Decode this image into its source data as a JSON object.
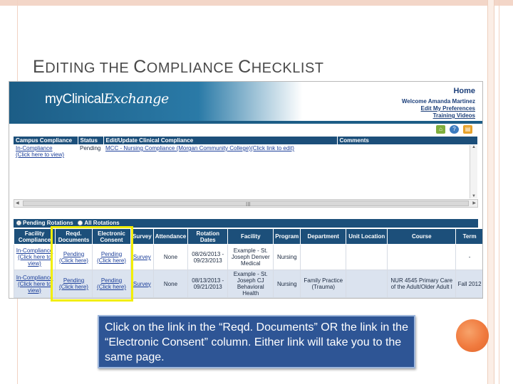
{
  "slide": {
    "title_parts": [
      "E",
      "DITING THE ",
      "C",
      "OMPLIANCE ",
      "C",
      "HECKLIST"
    ],
    "callout": "Click on the link in the “Reqd. Documents” OR the link in the “Electronic Consent” column.  Either link will take you to the same page."
  },
  "app": {
    "logo_prefix": "myClinical",
    "logo_suffix": "Exchange",
    "home": "Home",
    "welcome": "Welcome Amanda Martinez",
    "edit_prefs": "Edit My Preferences",
    "training": "Training Videos",
    "icons": [
      "home-icon",
      "help-icon",
      "print-icon"
    ]
  },
  "compliance": {
    "headers": [
      "Campus Compliance",
      "Status",
      "Edit/Update Clinical Compliance",
      "Comments"
    ],
    "row": {
      "campus_link": "In-Compliance",
      "campus_sub": "(Click here to view)",
      "status": "Pending",
      "edit_link": "MCC - Nursing Compliance (Morgan Community College)(Click link to edit)",
      "comments": ""
    },
    "scroll_grip": "III"
  },
  "rotations": {
    "pending_label": "Pending Rotations",
    "all_label": "All Rotations",
    "headers": [
      "Facility Compliance",
      "Reqd. Documents",
      "Electronic Consent",
      "Survey",
      "Attendance",
      "Rotation Dates",
      "Facility",
      "Program",
      "Department",
      "Unit Location",
      "Course",
      "Term"
    ],
    "rows": [
      {
        "facility_compliance": "In-Compliance",
        "facility_compliance_sub": "(Click here to view)",
        "reqd_docs": "Pending",
        "reqd_docs_sub": "(Click here)",
        "consent": "Pending",
        "consent_sub": "(Click here)",
        "survey": "Survey",
        "attendance": "None",
        "dates": "08/26/2013 - 09/23/2013",
        "facility": "Example - St. Joseph Denver Medical",
        "program": "Nursing",
        "department": "",
        "unit": "",
        "course": "",
        "term": "-"
      },
      {
        "facility_compliance": "In-Compliance",
        "facility_compliance_sub": "(Click here to view)",
        "reqd_docs": "Pending",
        "reqd_docs_sub": "(Click here)",
        "consent": "Pending",
        "consent_sub": "(Click here)",
        "survey": "Survey",
        "attendance": "None",
        "dates": "08/13/2013 - 09/21/2013",
        "facility": "Example - St. Joseph CJ Behavioral Health",
        "program": "Nursing",
        "department": "Family Practice (Trauma)",
        "unit": "",
        "course": "NUR 4545 Primary Care of the Adult/Older Adult I",
        "term": "Fall 2012"
      }
    ]
  }
}
